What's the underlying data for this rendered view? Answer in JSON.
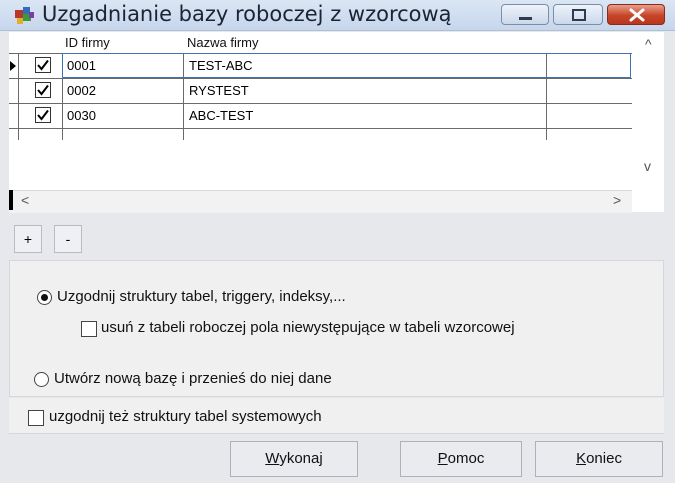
{
  "window": {
    "title": "Uzgadnianie bazy roboczej z wzorcową",
    "icons": {
      "app": "puzzle-app-icon",
      "minimize": "minimize-icon",
      "maximize": "maximize-icon",
      "close": "close-icon"
    }
  },
  "grid": {
    "columns": [
      "ID firmy",
      "Nazwa firmy"
    ],
    "rows": [
      {
        "checked": true,
        "id": "0001",
        "name": "TEST-ABC",
        "current": true
      },
      {
        "checked": true,
        "id": "0002",
        "name": "RYSTEST",
        "current": false
      },
      {
        "checked": true,
        "id": "0030",
        "name": "ABC-TEST",
        "current": false
      }
    ],
    "scroll_glyphs": {
      "up": "^",
      "down": "v",
      "left": "<",
      "right": ">"
    }
  },
  "row_buttons": {
    "add": "+",
    "remove": "-"
  },
  "options": {
    "sync_structures": {
      "label": "Uzgodnij struktury tabel, triggery, indeksy,...",
      "selected": true
    },
    "remove_fields": {
      "label": "usuń z tabeli roboczej pola niewystępujące w tabeli wzorcowej",
      "checked": false
    },
    "create_new": {
      "label": "Utwórz nową bazę i przenieś do niej dane",
      "selected": false
    },
    "system_tables": {
      "label": "uzgodnij też struktury tabel systemowych",
      "checked": false
    }
  },
  "buttons": {
    "execute": {
      "accel": "W",
      "rest": "ykonaj"
    },
    "help": {
      "accel": "P",
      "rest": "omoc"
    },
    "close": {
      "accel": "K",
      "rest": "oniec"
    }
  },
  "colors": {
    "title_gradient_top": "#dbe6f4",
    "close_button": "#c74529",
    "selection_outline": "#3b74b8"
  }
}
